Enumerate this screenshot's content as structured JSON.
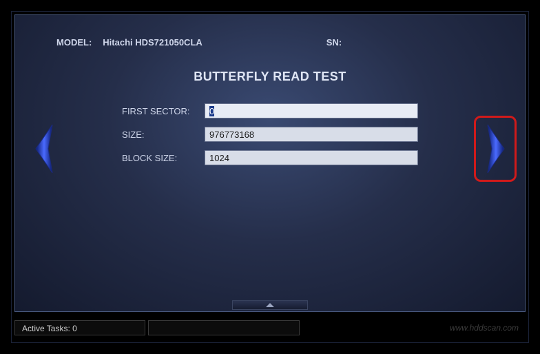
{
  "header": {
    "model_label": "MODEL:",
    "model_value": "Hitachi HDS721050CLA",
    "sn_label": "SN:",
    "sn_value": ""
  },
  "title": "BUTTERFLY READ TEST",
  "form": {
    "first_sector_label": "FIRST SECTOR:",
    "first_sector_value": "0",
    "size_label": "SIZE:",
    "size_value": "976773168",
    "block_size_label": "BLOCK SIZE:",
    "block_size_value": "1024"
  },
  "statusbar": {
    "active_tasks": "Active Tasks: 0",
    "watermark": "www.hddscan.com"
  },
  "colors": {
    "arrow_gradient_light": "#6a8aff",
    "arrow_gradient_dark": "#0a1a6a",
    "highlight": "#d11a1a"
  }
}
